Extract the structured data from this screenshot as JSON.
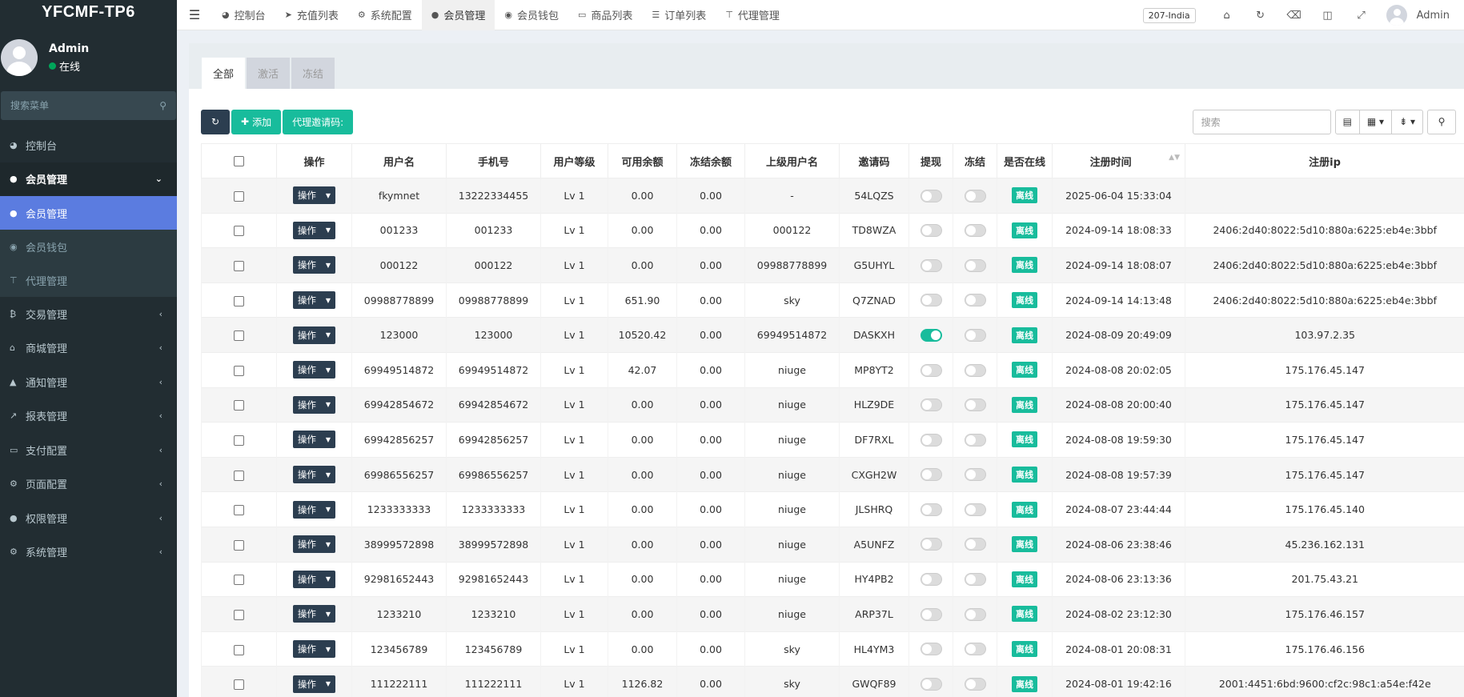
{
  "sidebar": {
    "logo": "YFCMF-TP6",
    "user_name": "Admin",
    "user_status": "在线",
    "search_placeholder": "搜索菜单",
    "items": [
      {
        "label": "控制台",
        "icon": "dashboard-icon"
      },
      {
        "label": "会员管理",
        "icon": "user-circle-icon",
        "open": true
      },
      {
        "label": "会员管理",
        "icon": "user-icon",
        "sub": true,
        "active": true
      },
      {
        "label": "会员钱包",
        "icon": "wallet-icon",
        "sub": true
      },
      {
        "label": "代理管理",
        "icon": "sitemap-icon",
        "sub": true
      },
      {
        "label": "交易管理",
        "icon": "bitcoin-icon"
      },
      {
        "label": "商城管理",
        "icon": "home-icon"
      },
      {
        "label": "通知管理",
        "icon": "bell-icon"
      },
      {
        "label": "报表管理",
        "icon": "line-chart-icon"
      },
      {
        "label": "支付配置",
        "icon": "credit-card-icon"
      },
      {
        "label": "页面配置",
        "icon": "cog-icon"
      },
      {
        "label": "权限管理",
        "icon": "users-icon"
      },
      {
        "label": "系统管理",
        "icon": "cogs-icon"
      }
    ]
  },
  "topbar": {
    "tabs": [
      {
        "label": "控制台",
        "icon": "dashboard-icon"
      },
      {
        "label": "充值列表",
        "icon": "sign-in-icon"
      },
      {
        "label": "系统配置",
        "icon": "cog-icon"
      },
      {
        "label": "会员管理",
        "icon": "user-icon",
        "active": true
      },
      {
        "label": "会员钱包",
        "icon": "wallet-icon"
      },
      {
        "label": "商品列表",
        "icon": "desktop-icon"
      },
      {
        "label": "订单列表",
        "icon": "list-icon"
      },
      {
        "label": "代理管理",
        "icon": "sitemap-icon"
      }
    ],
    "version_badge": "207-India",
    "admin_label": "Admin"
  },
  "panel": {
    "tabs": [
      "全部",
      "激活",
      "冻结"
    ],
    "add_label": "添加",
    "invite_label": "代理邀请码:",
    "search_placeholder": "搜索"
  },
  "table": {
    "headers": [
      "操作",
      "用户名",
      "手机号",
      "用户等级",
      "可用余额",
      "冻结余额",
      "上级用户名",
      "邀请码",
      "提现",
      "冻结",
      "是否在线",
      "注册时间",
      "注册ip"
    ],
    "op_label": "操作",
    "rows": [
      {
        "username": "fkymnet",
        "phone": "13222334455",
        "level": "Lv 1",
        "balance": "0.00",
        "frozen": "0.00",
        "parent": "-",
        "code": "54LQZS",
        "withdraw": false,
        "freeze": false,
        "online": "离线",
        "time": "2025-06-04 15:33:04",
        "ip": ""
      },
      {
        "username": "001233",
        "phone": "001233",
        "level": "Lv 1",
        "balance": "0.00",
        "frozen": "0.00",
        "parent": "000122",
        "code": "TD8WZA",
        "withdraw": false,
        "freeze": false,
        "online": "离线",
        "time": "2024-09-14 18:08:33",
        "ip": "2406:2d40:8022:5d10:880a:6225:eb4e:3bbf"
      },
      {
        "username": "000122",
        "phone": "000122",
        "level": "Lv 1",
        "balance": "0.00",
        "frozen": "0.00",
        "parent": "09988778899",
        "code": "G5UHYL",
        "withdraw": false,
        "freeze": false,
        "online": "离线",
        "time": "2024-09-14 18:08:07",
        "ip": "2406:2d40:8022:5d10:880a:6225:eb4e:3bbf"
      },
      {
        "username": "09988778899",
        "phone": "09988778899",
        "level": "Lv 1",
        "balance": "651.90",
        "frozen": "0.00",
        "parent": "sky",
        "code": "Q7ZNAD",
        "withdraw": false,
        "freeze": false,
        "online": "离线",
        "time": "2024-09-14 14:13:48",
        "ip": "2406:2d40:8022:5d10:880a:6225:eb4e:3bbf"
      },
      {
        "username": "123000",
        "phone": "123000",
        "level": "Lv 1",
        "balance": "10520.42",
        "frozen": "0.00",
        "parent": "69949514872",
        "code": "DASKXH",
        "withdraw": true,
        "freeze": false,
        "online": "离线",
        "time": "2024-08-09 20:49:09",
        "ip": "103.97.2.35"
      },
      {
        "username": "69949514872",
        "phone": "69949514872",
        "level": "Lv 1",
        "balance": "42.07",
        "frozen": "0.00",
        "parent": "niuge",
        "code": "MP8YT2",
        "withdraw": false,
        "freeze": false,
        "online": "离线",
        "time": "2024-08-08 20:02:05",
        "ip": "175.176.45.147"
      },
      {
        "username": "69942854672",
        "phone": "69942854672",
        "level": "Lv 1",
        "balance": "0.00",
        "frozen": "0.00",
        "parent": "niuge",
        "code": "HLZ9DE",
        "withdraw": false,
        "freeze": false,
        "online": "离线",
        "time": "2024-08-08 20:00:40",
        "ip": "175.176.45.147"
      },
      {
        "username": "69942856257",
        "phone": "69942856257",
        "level": "Lv 1",
        "balance": "0.00",
        "frozen": "0.00",
        "parent": "niuge",
        "code": "DF7RXL",
        "withdraw": false,
        "freeze": false,
        "online": "离线",
        "time": "2024-08-08 19:59:30",
        "ip": "175.176.45.147"
      },
      {
        "username": "69986556257",
        "phone": "69986556257",
        "level": "Lv 1",
        "balance": "0.00",
        "frozen": "0.00",
        "parent": "niuge",
        "code": "CXGH2W",
        "withdraw": false,
        "freeze": false,
        "online": "离线",
        "time": "2024-08-08 19:57:39",
        "ip": "175.176.45.147"
      },
      {
        "username": "1233333333",
        "phone": "1233333333",
        "level": "Lv 1",
        "balance": "0.00",
        "frozen": "0.00",
        "parent": "niuge",
        "code": "JLSHRQ",
        "withdraw": false,
        "freeze": false,
        "online": "离线",
        "time": "2024-08-07 23:44:44",
        "ip": "175.176.45.140"
      },
      {
        "username": "38999572898",
        "phone": "38999572898",
        "level": "Lv 1",
        "balance": "0.00",
        "frozen": "0.00",
        "parent": "niuge",
        "code": "A5UNFZ",
        "withdraw": false,
        "freeze": false,
        "online": "离线",
        "time": "2024-08-06 23:38:46",
        "ip": "45.236.162.131"
      },
      {
        "username": "92981652443",
        "phone": "92981652443",
        "level": "Lv 1",
        "balance": "0.00",
        "frozen": "0.00",
        "parent": "niuge",
        "code": "HY4PB2",
        "withdraw": false,
        "freeze": false,
        "online": "离线",
        "time": "2024-08-06 23:13:36",
        "ip": "201.75.43.21"
      },
      {
        "username": "1233210",
        "phone": "1233210",
        "level": "Lv 1",
        "balance": "0.00",
        "frozen": "0.00",
        "parent": "niuge",
        "code": "ARP37L",
        "withdraw": false,
        "freeze": false,
        "online": "离线",
        "time": "2024-08-02 23:12:30",
        "ip": "175.176.46.157"
      },
      {
        "username": "123456789",
        "phone": "123456789",
        "level": "Lv 1",
        "balance": "0.00",
        "frozen": "0.00",
        "parent": "sky",
        "code": "HL4YM3",
        "withdraw": false,
        "freeze": false,
        "online": "离线",
        "time": "2024-08-01 20:08:31",
        "ip": "175.176.46.156"
      },
      {
        "username": "111222111",
        "phone": "111222111",
        "level": "Lv 1",
        "balance": "1126.82",
        "frozen": "0.00",
        "parent": "sky",
        "code": "GWQF89",
        "withdraw": false,
        "freeze": false,
        "online": "离线",
        "time": "2024-08-01 19:42:16",
        "ip": "2001:4451:6bd:9600:cf2c:98c1:a54e:f42e"
      }
    ]
  },
  "colors": {
    "sidebar_bg": "#222d32",
    "active_menu": "#5b7ce0",
    "accent_green": "#18bc9c",
    "dark_button": "#2c3e50"
  }
}
